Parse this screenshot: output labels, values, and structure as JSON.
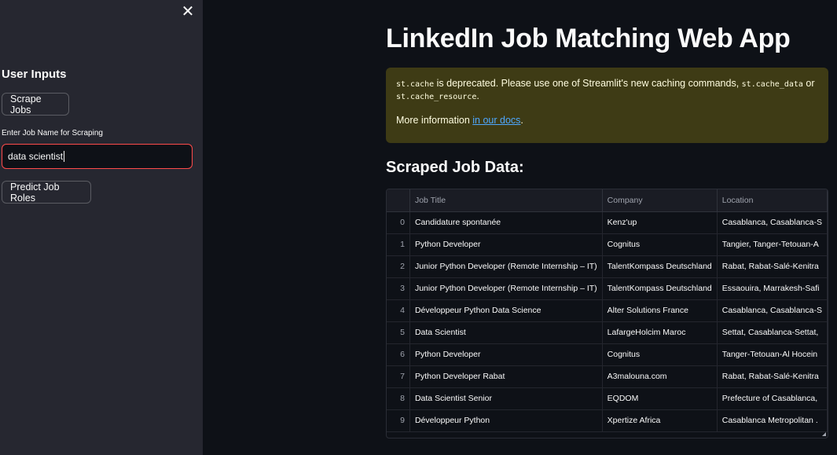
{
  "sidebar": {
    "title": "User Inputs",
    "scrape_button": "Scrape Jobs",
    "input_label": "Enter Job Name for Scraping",
    "input_value": "data scientist",
    "predict_button": "Predict Job Roles",
    "close_icon": "close-icon"
  },
  "main": {
    "title": "LinkedIn Job Matching Web App",
    "warning": {
      "code1": "st.cache",
      "text1": " is deprecated. Please use one of Streamlit's new caching commands, ",
      "code2": "st.cache_data",
      "text2": " or",
      "code3": "st.cache_resource",
      "text3": ".",
      "more_text": "More information ",
      "link_text": "in our docs",
      "period": "."
    },
    "section_title": "Scraped Job Data:",
    "table": {
      "columns": [
        "",
        "Job Title",
        "Company",
        "Location"
      ],
      "rows": [
        [
          "0",
          "Candidature spontanée",
          "Kenz'up",
          "Casablanca, Casablanca-S"
        ],
        [
          "1",
          "Python Developer",
          "Cognitus",
          "Tangier, Tanger-Tetouan-A"
        ],
        [
          "2",
          "Junior Python Developer (Remote Internship – IT)",
          "TalentKompass Deutschland",
          "Rabat, Rabat-Salé-Kenitra"
        ],
        [
          "3",
          "Junior Python Developer (Remote Internship – IT)",
          "TalentKompass Deutschland",
          "Essaouira, Marrakesh-Safi"
        ],
        [
          "4",
          "Développeur Python Data Science",
          "Alter Solutions France",
          "Casablanca, Casablanca-S"
        ],
        [
          "5",
          "Data Scientist",
          "LafargeHolcim Maroc",
          "Settat, Casablanca-Settat,"
        ],
        [
          "6",
          "Python Developer",
          "Cognitus",
          "Tanger-Tetouan-Al Hocein"
        ],
        [
          "7",
          "Python Developer Rabat",
          "A3malouna.com",
          "Rabat, Rabat-Salé-Kenitra"
        ],
        [
          "8",
          "Data Scientist Senior",
          "EQDOM",
          "Prefecture of Casablanca,"
        ],
        [
          "9",
          "Développeur Python",
          "Xpertize Africa",
          "Casablanca Metropolitan ."
        ]
      ]
    }
  },
  "colors": {
    "background": "#0e1117",
    "sidebar": "#262730",
    "warning_bg": "#3e3b15",
    "input_border": "#ff4b4b",
    "link": "#4ea8ff"
  }
}
